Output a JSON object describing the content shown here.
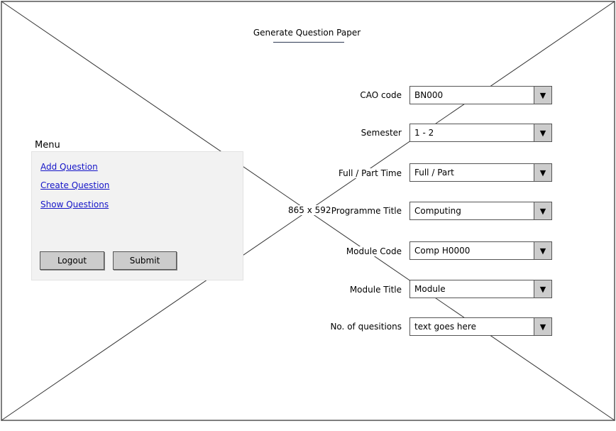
{
  "page": {
    "title": "Generate Question Paper",
    "dimensions_label": "865 x 592"
  },
  "menu": {
    "label": "Menu",
    "links": [
      "Add Question",
      "Create Question",
      "Show Questions"
    ],
    "logout_label": "Logout",
    "submit_label": "Submit"
  },
  "form": {
    "fields": [
      {
        "label": "CAO code",
        "value": "BN000"
      },
      {
        "label": "Semester",
        "value": "1 - 2"
      },
      {
        "label": "Full / Part Time",
        "value": "Full / Part"
      },
      {
        "label": "Programme Title",
        "value": "Computing"
      },
      {
        "label": "Module Code",
        "value": "Comp H0000"
      },
      {
        "label": "Module Title",
        "value": "Module"
      },
      {
        "label": "No. of quesitions",
        "value": "text goes here"
      }
    ]
  },
  "icons": {
    "dropdown": "triangle-down-icon"
  }
}
